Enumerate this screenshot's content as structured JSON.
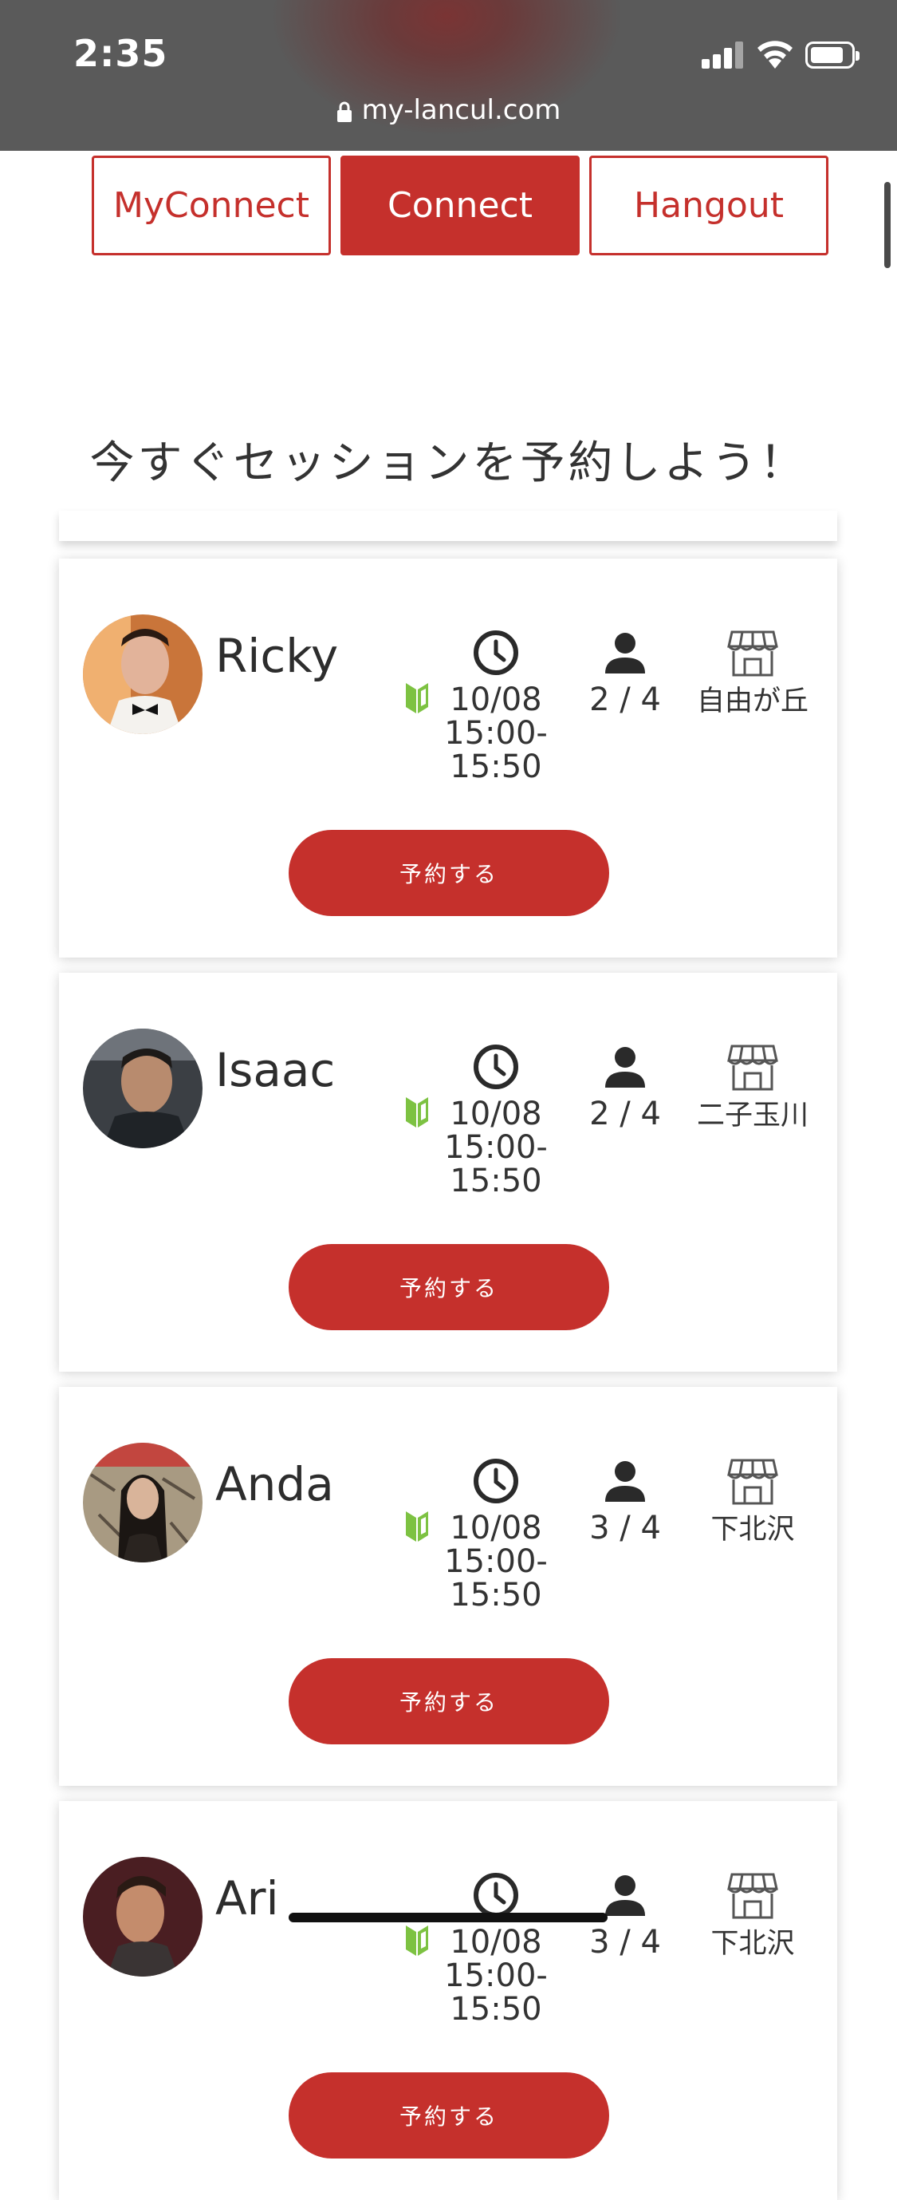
{
  "status_bar": {
    "time": "2:35"
  },
  "browser": {
    "url": "my-lancul.com"
  },
  "tabs": [
    {
      "label": "MyConnect",
      "active": false
    },
    {
      "label": "Connect",
      "active": true
    },
    {
      "label": "Hangout",
      "active": false
    }
  ],
  "heading": "今すぐセッションを予約しよう！",
  "sessions": [
    {
      "name": "Ricky",
      "date": "10/08",
      "time_start": "15:00-",
      "time_end": "15:50",
      "capacity": "2 / 4",
      "location": "自由が丘",
      "button": "予約する"
    },
    {
      "name": "Isaac",
      "date": "10/08",
      "time_start": "15:00-",
      "time_end": "15:50",
      "capacity": "2 / 4",
      "location": "二子玉川",
      "button": "予約する"
    },
    {
      "name": "Anda",
      "date": "10/08",
      "time_start": "15:00-",
      "time_end": "15:50",
      "capacity": "3 / 4",
      "location": "下北沢",
      "button": "予約する"
    },
    {
      "name": "Ari",
      "date": "10/08",
      "time_start": "15:00-",
      "time_end": "15:50",
      "capacity": "3 / 4",
      "location": "下北沢",
      "button": "予約する"
    }
  ],
  "colors": {
    "accent": "#c5302c",
    "beginner_mark": "#7dc242"
  }
}
